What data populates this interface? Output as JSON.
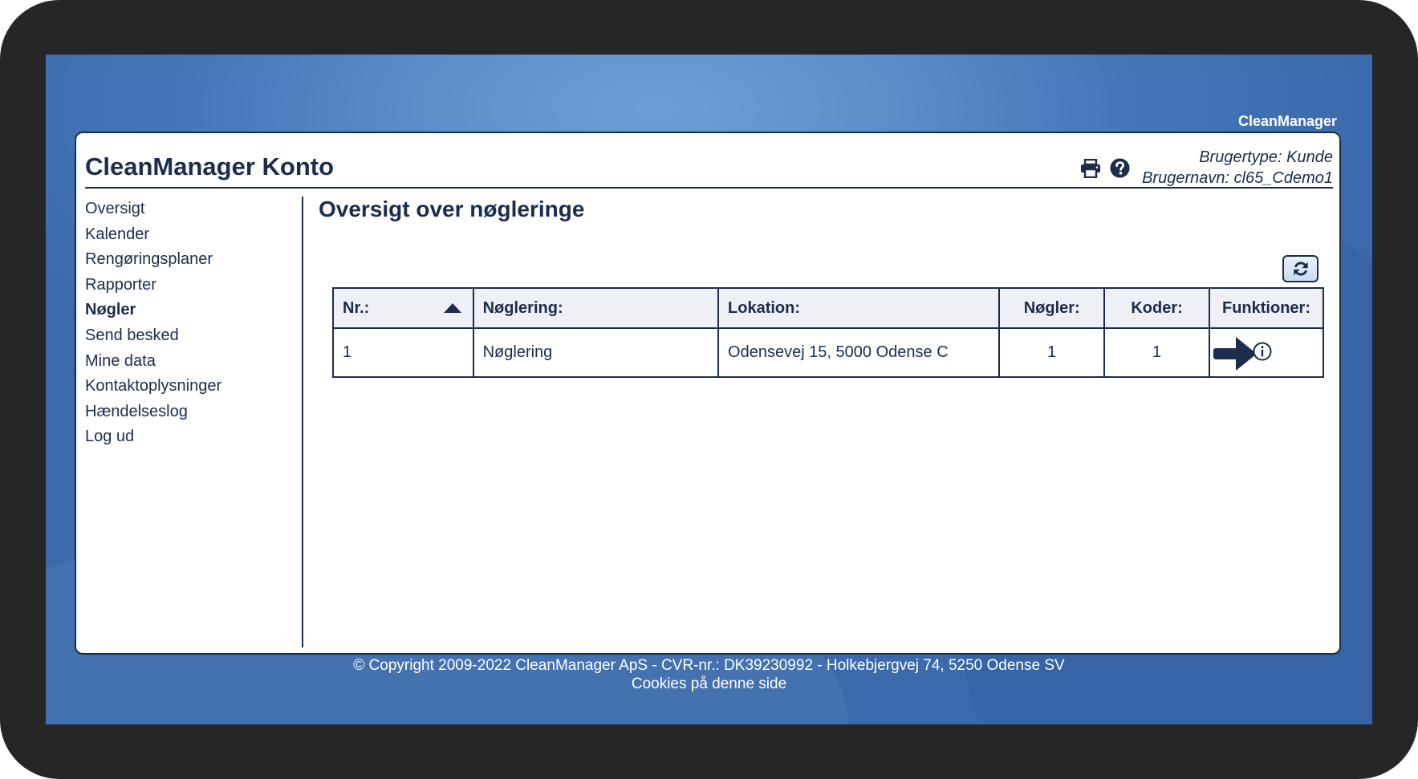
{
  "brand": "CleanManager",
  "header": {
    "title": "CleanManager Konto",
    "icons": [
      "print-icon",
      "help-icon"
    ],
    "user_type": "Brugertype: Kunde",
    "username": "Brugernavn: cl65_Cdemo1"
  },
  "sidebar": {
    "items": [
      {
        "label": "Oversigt",
        "active": false
      },
      {
        "label": "Kalender",
        "active": false
      },
      {
        "label": "Rengøringsplaner",
        "active": false
      },
      {
        "label": "Rapporter",
        "active": false
      },
      {
        "label": "Nøgler",
        "active": true
      },
      {
        "label": "Send besked",
        "active": false
      },
      {
        "label": "Mine data",
        "active": false
      },
      {
        "label": "Kontaktoplysninger",
        "active": false
      },
      {
        "label": "Hændelseslog",
        "active": false
      },
      {
        "label": "Log ud",
        "active": false
      }
    ]
  },
  "main": {
    "title": "Oversigt over nøgleringe",
    "refresh_icon": "refresh-icon",
    "table": {
      "headers": [
        "Nr.:",
        "Nøglering:",
        "Lokation:",
        "Nøgler:",
        "Koder:",
        "Funktioner:"
      ],
      "sort": {
        "column": "Nr.:",
        "direction": "ascending"
      },
      "rows": [
        {
          "nr": "1",
          "name": "Nøglering",
          "location": "Odensevej 15, 5000 Odense C",
          "keys": "1",
          "codes": "1",
          "functions": [
            "arrow-right-icon",
            "info-icon"
          ]
        }
      ]
    }
  },
  "footer": {
    "copyright": "© Copyright 2009-2022 CleanManager ApS - CVR-nr.: DK39230992 - Holkebjergvej 74, 5250 Odense SV",
    "cookies": "Cookies på denne side"
  },
  "colors": {
    "primary": "#1b2c4c",
    "background_blue": "#5a8cc9",
    "table_header_bg": "#eef0f6",
    "device_frame": "#262626"
  }
}
